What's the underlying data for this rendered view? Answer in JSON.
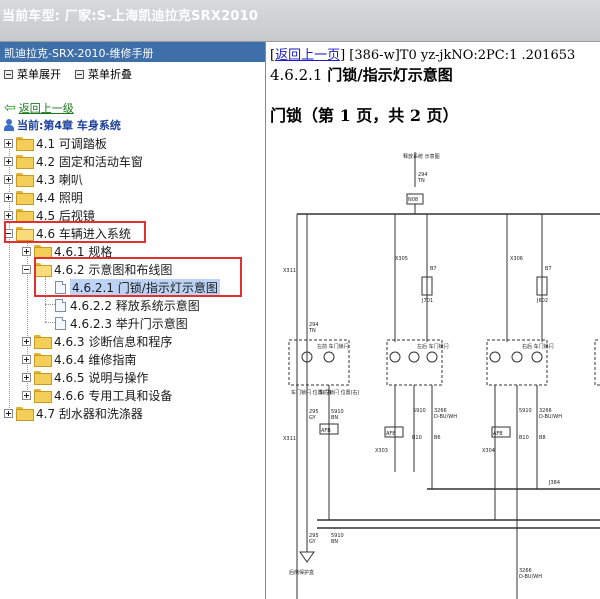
{
  "header": {
    "title": "当前车型:  厂家:S-上海凯迪拉克SRX2010"
  },
  "left_panel": {
    "title": "凯迪拉克-SRX-2010-维修手册",
    "toolbar": {
      "expand_label": "菜单展开",
      "collapse_label": "菜单折叠"
    },
    "back_label": "返回上一级",
    "current_label": "当前:第4章 车身系统",
    "tree": [
      {
        "label": "4.1 可调踏板"
      },
      {
        "label": "4.2 固定和活动车窗"
      },
      {
        "label": "4.3 喇叭"
      },
      {
        "label": "4.4 照明"
      },
      {
        "label": "4.5 后视镜"
      },
      {
        "label": "4.6 车辆进入系统"
      },
      {
        "label": "4.6.1 规格"
      },
      {
        "label": "4.6.2 示意图和布线图"
      },
      {
        "label": "4.6.2.1 门锁/指示灯示意图"
      },
      {
        "label": "4.6.2.2 释放系统示意图"
      },
      {
        "label": "4.6.2.3 举升门示意图"
      },
      {
        "label": "4.6.3 诊断信息和程序"
      },
      {
        "label": "4.6.4 维修指南"
      },
      {
        "label": "4.6.5 说明与操作"
      },
      {
        "label": "4.6.6 专用工具和设备"
      },
      {
        "label": "4.7 刮水器和洗涤器"
      }
    ]
  },
  "content": {
    "back_link": "返回上一页",
    "breadcrumb_rest": "] [386-w]T0 yz-jkNO:2PC:1 .201653",
    "section_num": "4.6.2.1",
    "section_title": "门锁/指示灯示意图",
    "page_title": "门锁（第 1 页，共 2 页）"
  },
  "diagram": {
    "labels": {
      "top_module": "释放系统\n示意图",
      "wire_294": "294",
      "wire_tn": "TN",
      "conn_n08": "N08",
      "conn_x311": "X311",
      "conn_x305": "X305",
      "conn_x306": "X306",
      "conn_x303": "X303",
      "conn_x304": "X304",
      "conn_j701": "J701",
      "conn_j602": "J602",
      "conn_j384": "J384",
      "b7": "B7",
      "b6": "B6",
      "b8": "B8",
      "b10": "B10",
      "afb": "AFB",
      "s910": "5910",
      "bn": "BN",
      "s295": "295",
      "gy": "GY",
      "s3266": "3266",
      "dbuwh": "D-BU/WH",
      "actuator_front_left": "左前\n车门锁闩",
      "actuator_rear_left": "左后\n车门锁闩",
      "actuator_right_rear": "右后\n车门锁闩",
      "ground": "后侧保护盒",
      "lock_fl_a": "车门锁闩\n位置(左)",
      "lock_fl_b": "车门锁闩\n位置(右)"
    }
  }
}
